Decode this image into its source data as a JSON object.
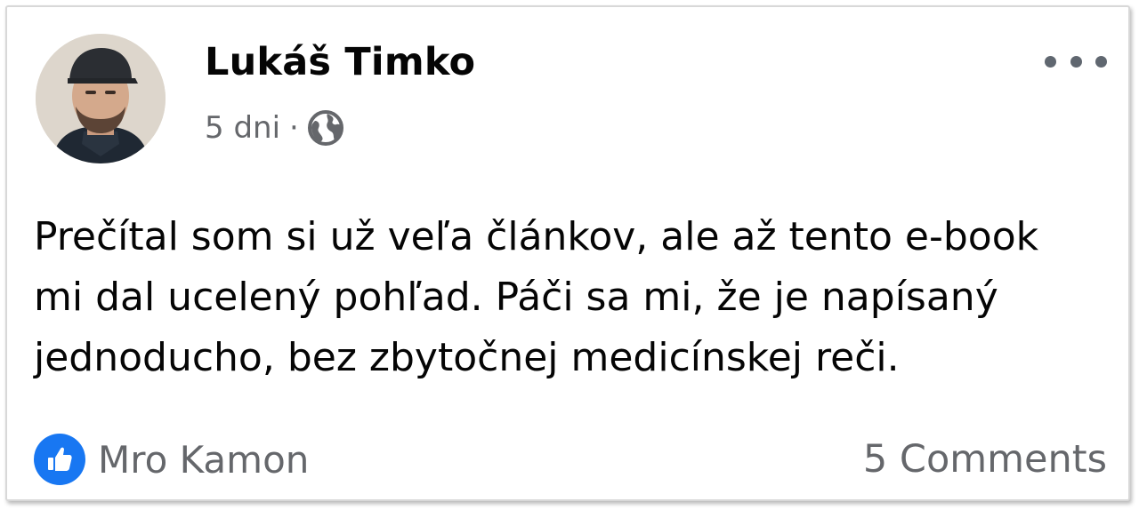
{
  "post": {
    "author_name": "Lukáš Timko",
    "time": "5 dni",
    "separator": "·",
    "privacy_icon": "globe-icon",
    "more_icon": "more-options-icon",
    "text_lines": [
      "Prečítal som si už veľa článkov, ale až tento e-book",
      "mi dal ucelený pohľad. Páči sa mi, že je napísaný",
      "jednoducho, bez zbytočnej medicínskej reči."
    ]
  },
  "reactions": {
    "icon": "like-icon",
    "reactor_name": "Mro Kamon"
  },
  "comments": {
    "label": "5 Comments"
  },
  "colors": {
    "like_blue": "#1877f2",
    "meta_gray": "#65676b",
    "text": "#050505"
  }
}
